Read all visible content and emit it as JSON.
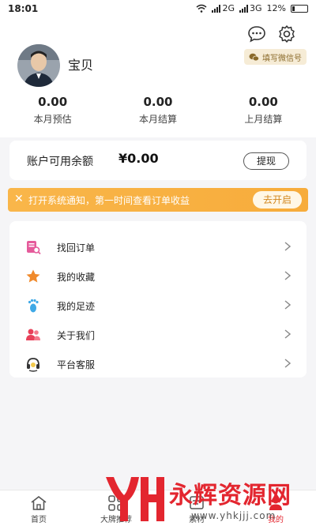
{
  "status_bar": {
    "time": "18:01",
    "network_1": "2G",
    "network_2": "3G",
    "battery": "12%"
  },
  "profile": {
    "username": "宝贝",
    "wechat_tag": "填写微信号"
  },
  "stats": [
    {
      "value": "0.00",
      "label": "本月预估"
    },
    {
      "value": "0.00",
      "label": "本月结算"
    },
    {
      "value": "0.00",
      "label": "上月结算"
    }
  ],
  "balance": {
    "label": "账户可用余额",
    "amount": "¥0.00",
    "withdraw_label": "提现"
  },
  "notice": {
    "text": "打开系统通知，第一时间查看订单收益",
    "button_label": "去开启"
  },
  "menu": [
    {
      "label": "找回订单",
      "icon": "order-search-icon"
    },
    {
      "label": "我的收藏",
      "icon": "star-icon"
    },
    {
      "label": "我的足迹",
      "icon": "footprint-icon"
    },
    {
      "label": "关于我们",
      "icon": "users-icon"
    },
    {
      "label": "平台客服",
      "icon": "headset-icon"
    }
  ],
  "tabbar": [
    {
      "label": "首页",
      "icon": "home-icon"
    },
    {
      "label": "大牌推荐",
      "icon": "grid-icon"
    },
    {
      "label": "素材",
      "icon": "material-icon"
    },
    {
      "label": "我的",
      "icon": "user-icon"
    }
  ],
  "watermark": {
    "text": "永辉资源网",
    "url": "www.yhkjjj.com"
  },
  "colors": {
    "notice_bg": "#f7ac3b",
    "accent_red": "#e3262f",
    "tag_bg": "#f6ecd6"
  }
}
